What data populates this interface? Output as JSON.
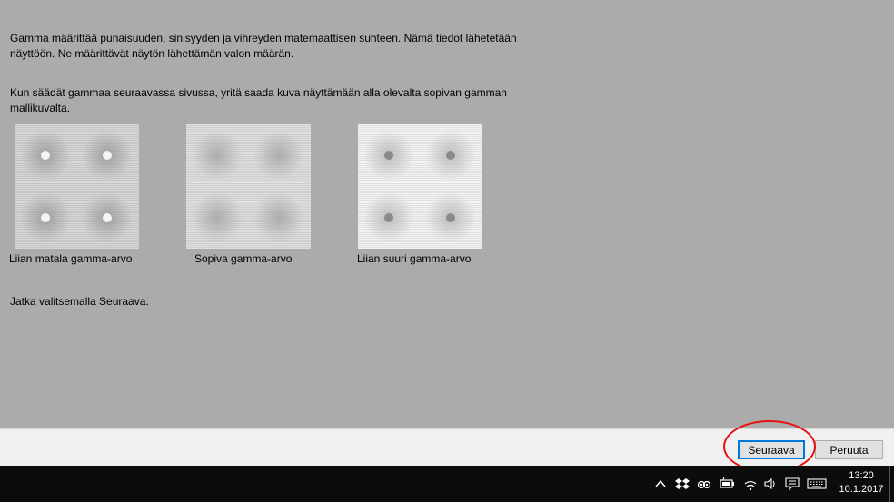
{
  "intro": {
    "paragraph1": "Gamma määrittää punaisuuden, sinisyyden ja vihreyden matemaattisen suhteen. Nämä tiedot lähetetään näyttöön. Ne määrittävät näytön lähettämän valon määrän.",
    "paragraph2": "Kun säädät gammaa seuraavassa sivussa, yritä saada kuva näyttämään alla olevalta sopivan gamman mallikuvalta."
  },
  "samples": [
    {
      "caption": "Liian matala gamma-arvo",
      "dot_color": "#f4f4f4"
    },
    {
      "caption": "Sopiva gamma-arvo",
      "dot_color": "#c8c8c8"
    },
    {
      "caption": "Liian suuri gamma-arvo",
      "dot_color": "#8a8a8a"
    }
  ],
  "instruction": "Jatka valitsemalla Seuraava.",
  "buttons": {
    "next_label": "Seuraava",
    "cancel_label": "Peruuta"
  },
  "taskbar": {
    "tray_icons": [
      "chevron-up-icon",
      "dropbox-icon",
      "tripadvisor-icon",
      "battery-charging-icon",
      "wifi-icon",
      "volume-icon",
      "action-center-icon",
      "keyboard-icon"
    ],
    "time": "13:20",
    "date": "10.1.2017"
  },
  "colors": {
    "background": "#ababab",
    "highlight": "#e81010",
    "taskbar": "#0c0c0c",
    "footer": "#f0f0f0"
  }
}
